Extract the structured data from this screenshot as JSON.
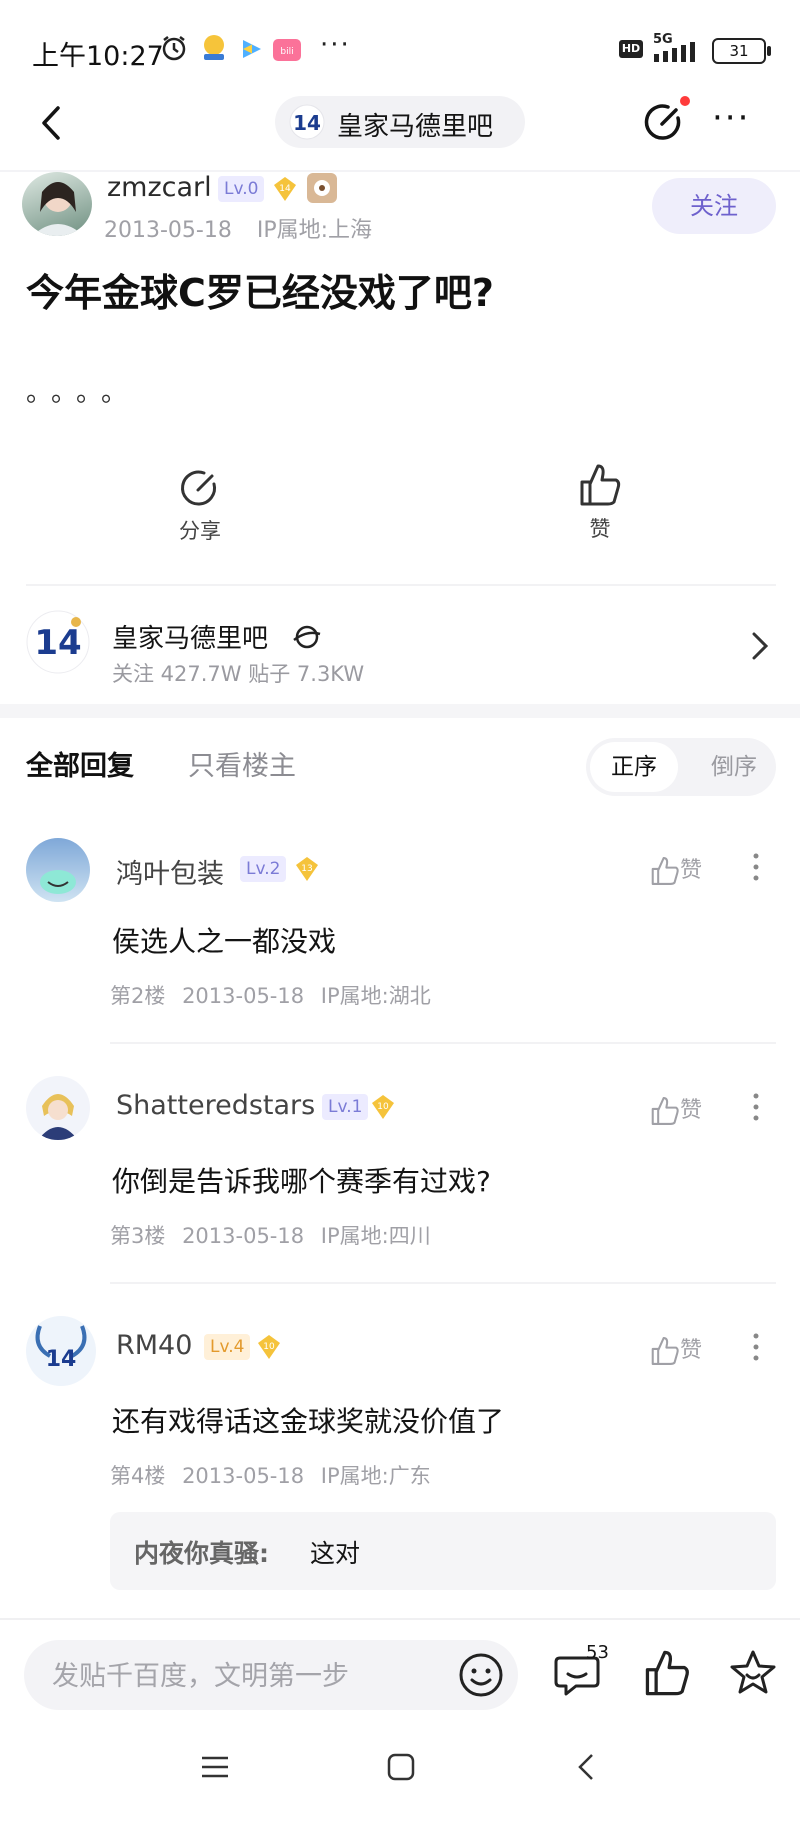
{
  "status_bar": {
    "time": "上午10:27",
    "network": "5G",
    "hd": "HD",
    "battery": "31"
  },
  "nav": {
    "forum_name": "皇家马德里吧"
  },
  "post": {
    "author": "zmzcarl",
    "author_level": "Lv.0",
    "author_badge": "14",
    "date": "2013-05-18",
    "ip": "IP属地:上海",
    "follow_label": "关注",
    "title": "今年金球C罗已经没戏了吧?",
    "body": "。。。。",
    "share_label": "分享",
    "like_label": "赞"
  },
  "forum_card": {
    "name": "皇家马德里吧",
    "stats": "关注 427.7W   贴子 7.3KW"
  },
  "tabs": {
    "all": "全部回复",
    "owner_only": "只看楼主"
  },
  "sort": {
    "asc": "正序",
    "desc": "倒序"
  },
  "replies": [
    {
      "name": "鸿叶包装",
      "level": "Lv.2",
      "badge": "13",
      "text": "侯选人之一都没戏",
      "floor": "第2楼",
      "date": "2013-05-18",
      "ip": "IP属地:湖北",
      "like": "赞"
    },
    {
      "name": "Shatteredstars",
      "level": "Lv.1",
      "badge": "10",
      "text": "你倒是告诉我哪个赛季有过戏?",
      "floor": "第3楼",
      "date": "2013-05-18",
      "ip": "IP属地:四川",
      "like": "赞"
    },
    {
      "name": "RM40",
      "level": "Lv.4",
      "badge": "10",
      "text": "还有戏得话这金球奖就没价值了",
      "floor": "第4楼",
      "date": "2013-05-18",
      "ip": "IP属地:广东",
      "like": "赞",
      "sub_reply": {
        "author": "内夜你真骚:",
        "text": "这对"
      }
    }
  ],
  "bottom_bar": {
    "placeholder": "发贴千百度，文明第一步",
    "comment_count": "53"
  },
  "colors": {
    "accent": "#6e61cd",
    "badge_gold": "#f5c33b",
    "level_blue": "#7b7bd6",
    "level_orange": "#e39a2d"
  }
}
